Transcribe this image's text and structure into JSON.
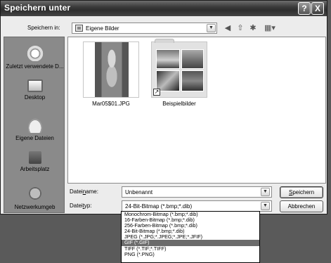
{
  "window": {
    "title": "Speichern unter",
    "help_label": "?",
    "close_label": "X"
  },
  "lookin": {
    "label": "Speichern in:",
    "value": "Eigene Bilder",
    "icon": "folder-icon"
  },
  "toolbar": {
    "icons": [
      "back-icon",
      "up-folder-icon",
      "new-folder-icon",
      "views-icon"
    ]
  },
  "places": [
    {
      "label": "Zuletzt verwendete D...",
      "icon": "recent-documents-icon"
    },
    {
      "label": "Desktop",
      "icon": "desktop-icon"
    },
    {
      "label": "Eigene Dateien",
      "icon": "my-documents-icon"
    },
    {
      "label": "Arbeitsplatz",
      "icon": "my-computer-icon"
    },
    {
      "label": "Netzwerkumgeb",
      "icon": "network-icon"
    }
  ],
  "files": [
    {
      "name": "Mar05$01.JPG",
      "type": "image"
    },
    {
      "name": "Beispielbilder",
      "type": "folder-shortcut"
    }
  ],
  "filename": {
    "label_pre": "Datei",
    "label_u": "n",
    "label_post": "ame:",
    "value": "Unbenannt"
  },
  "filetype": {
    "label_pre": "Datei",
    "label_u": "t",
    "label_post": "yp:",
    "value": "24-Bit-Bitmap (*.bmp;*.dib)",
    "options": [
      "Monochrom-Bitmap (*.bmp;*.dib)",
      "16-Farben-Bitmap (*.bmp;*.dib)",
      "256-Farben-Bitmap (*.bmp;*.dib)",
      "24-Bit-Bitmap (*.bmp;*.dib)",
      "JPEG (*.JPG;*.JPEG;*.JPE;*.JFIF)",
      "GIF (*.GIF)",
      "TIFF (*.TIF;*.TIFF)",
      "PNG (*.PNG)"
    ],
    "highlighted_index": 5
  },
  "buttons": {
    "save_u": "S",
    "save_rest": "peichern",
    "cancel": "Abbrechen"
  }
}
